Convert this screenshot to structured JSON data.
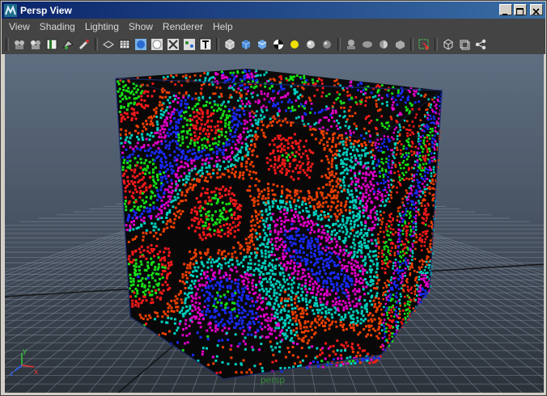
{
  "window": {
    "title": "Persp View",
    "controls": [
      "minimize-icon",
      "maximize-icon",
      "close-icon"
    ]
  },
  "menu": {
    "items": [
      {
        "label": "View"
      },
      {
        "label": "Shading"
      },
      {
        "label": "Lighting"
      },
      {
        "label": "Show"
      },
      {
        "label": "Renderer"
      },
      {
        "label": "Help"
      }
    ]
  },
  "toolbar": {
    "icons": [
      "select-camera-icon",
      "lock-camera-icon",
      "bookmark-icon",
      "image-plane-icon",
      "camera-attributes-icon",
      "wireframe-icon",
      "grid-icon",
      "smooth-shade-icon",
      "flat-shade-icon",
      "xray-icon",
      "joints-icon",
      "textured-icon",
      "wire-cube-icon",
      "shaded-cube-icon",
      "default-material-icon",
      "checker-icon",
      "use-all-lights-icon",
      "default-light-icon",
      "shadows-icon",
      "isolate-icon",
      "sphere-icon",
      "half-sphere-icon",
      "cube-flat-icon",
      "select-region-icon",
      "frame-all-icon",
      "frame-selected-icon",
      "connections-icon"
    ]
  },
  "viewport": {
    "camera_label": "persp",
    "axis_labels": {
      "y": "y",
      "x": "x",
      "z": "z"
    }
  },
  "colors": {
    "titlebar_start": "#0a246a",
    "titlebar_end": "#3a6ea5",
    "menubar": "#444444",
    "viewport_top": "#5e6e80",
    "viewport_bottom": "#2c323a"
  }
}
